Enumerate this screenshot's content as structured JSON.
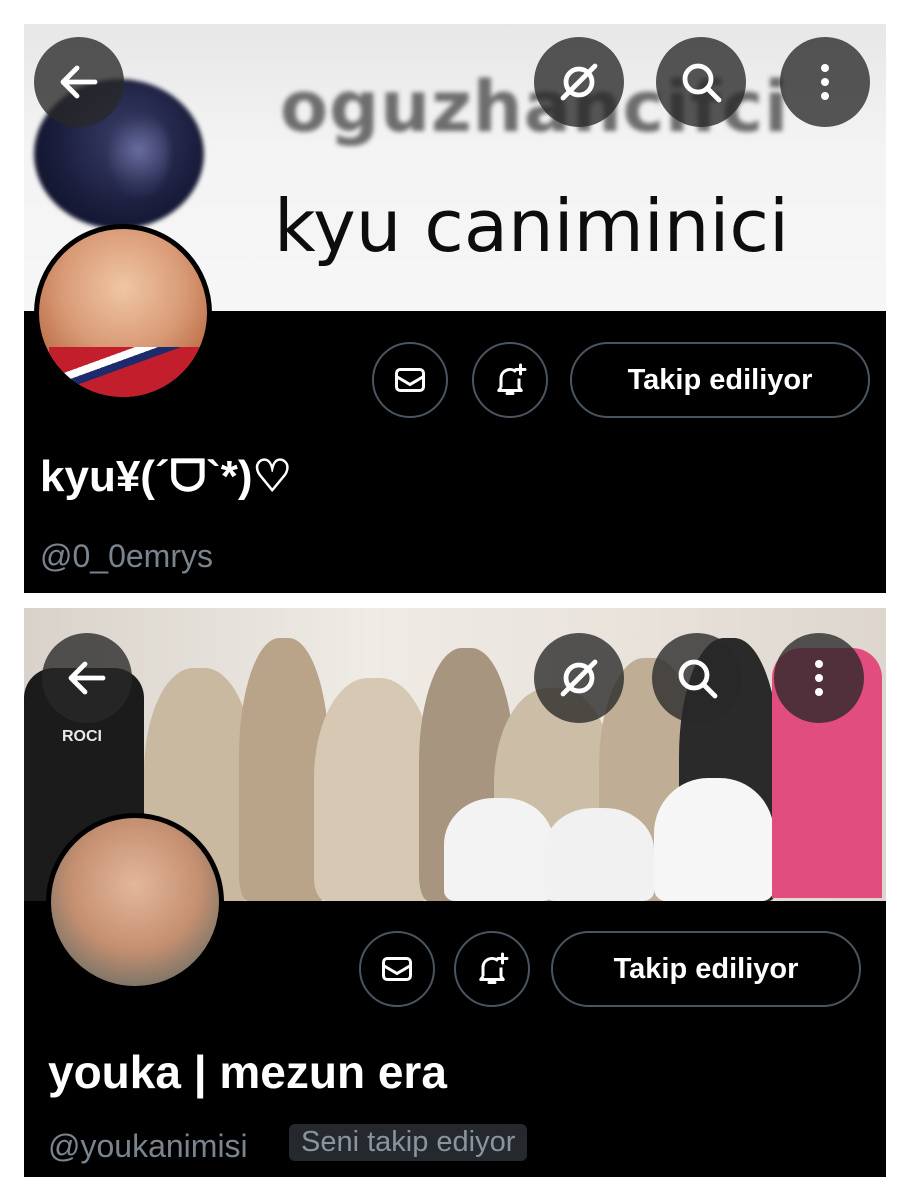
{
  "profiles": [
    {
      "banner": {
        "blurred_text": "oguzhancifci",
        "headline": "kyu caniminici"
      },
      "toolbar": {
        "back": "arrow-left-icon",
        "grok": "grok-icon",
        "search": "search-icon",
        "more": "more-vertical-icon"
      },
      "actions": {
        "message": "mail-icon",
        "notify": "bell-plus-icon",
        "follow_label": "Takip ediliyor"
      },
      "display_name": "kyu¥(´ᗜ`*)♡",
      "handle": "@0_0emrys"
    },
    {
      "banner": {
        "shirt_text": "ROCI"
      },
      "toolbar": {
        "back": "arrow-left-icon",
        "grok": "grok-icon",
        "search": "search-icon",
        "more": "more-vertical-icon"
      },
      "actions": {
        "message": "mail-icon",
        "notify": "bell-plus-icon",
        "follow_label": "Takip ediliyor"
      },
      "display_name": "youka | mezun era",
      "handle": "@youkanimisi",
      "follows_you_badge": "Seni takip ediyor"
    }
  ],
  "colors": {
    "background": "#000000",
    "button_border": "#4a5560",
    "handle": "#7a848e",
    "badge_bg": "#25292e"
  }
}
